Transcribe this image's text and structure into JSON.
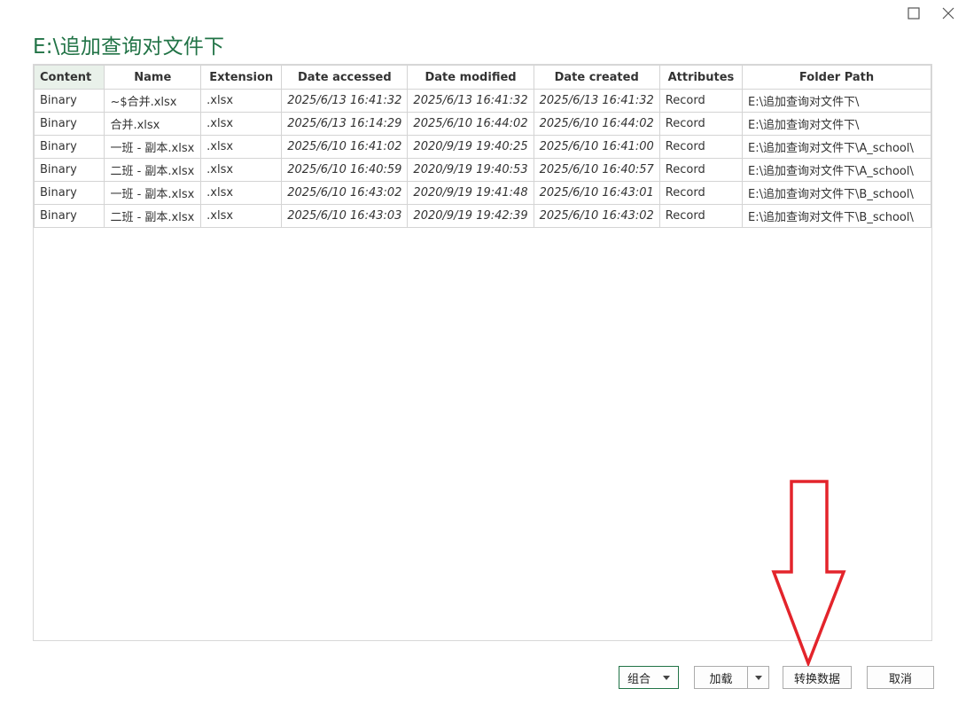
{
  "window": {
    "title": "E:\\追加查询对文件下",
    "maximize_icon": "maximize-icon",
    "close_icon": "close-icon"
  },
  "colors": {
    "accent": "#217346",
    "header_highlight": "#e9f1ea",
    "annotation_arrow": "#e3242b"
  },
  "table": {
    "columns": [
      "Content",
      "Name",
      "Extension",
      "Date accessed",
      "Date modified",
      "Date created",
      "Attributes",
      "Folder Path"
    ],
    "rows": [
      [
        "Binary",
        "~$合并.xlsx",
        ".xlsx",
        "2025/6/13 16:41:32",
        "2025/6/13 16:41:32",
        "2025/6/13 16:41:32",
        "Record",
        "E:\\追加查询对文件下\\"
      ],
      [
        "Binary",
        "合并.xlsx",
        ".xlsx",
        "2025/6/13 16:14:29",
        "2025/6/10 16:44:02",
        "2025/6/10 16:44:02",
        "Record",
        "E:\\追加查询对文件下\\"
      ],
      [
        "Binary",
        "一班 - 副本.xlsx",
        ".xlsx",
        "2025/6/10 16:41:02",
        "2020/9/19 19:40:25",
        "2025/6/10 16:41:00",
        "Record",
        "E:\\追加查询对文件下\\A_school\\"
      ],
      [
        "Binary",
        "二班 - 副本.xlsx",
        ".xlsx",
        "2025/6/10 16:40:59",
        "2020/9/19 19:40:53",
        "2025/6/10 16:40:57",
        "Record",
        "E:\\追加查询对文件下\\A_school\\"
      ],
      [
        "Binary",
        "一班 - 副本.xlsx",
        ".xlsx",
        "2025/6/10 16:43:02",
        "2020/9/19 19:41:48",
        "2025/6/10 16:43:01",
        "Record",
        "E:\\追加查询对文件下\\B_school\\"
      ],
      [
        "Binary",
        "二班 - 副本.xlsx",
        ".xlsx",
        "2025/6/10 16:43:03",
        "2020/9/19 19:42:39",
        "2025/6/10 16:43:02",
        "Record",
        "E:\\追加查询对文件下\\B_school\\"
      ]
    ]
  },
  "buttons": {
    "combine": "组合",
    "load": "加载",
    "transform": "转换数据",
    "cancel": "取消"
  }
}
